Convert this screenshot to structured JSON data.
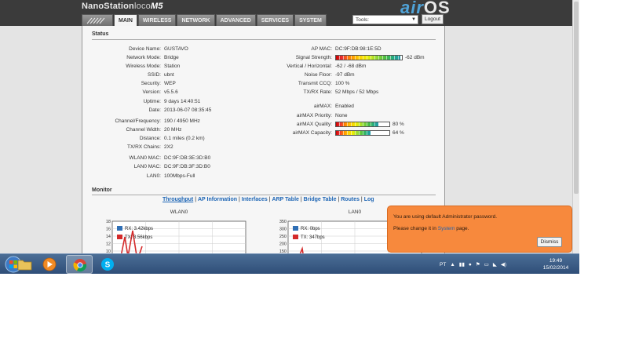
{
  "header": {
    "brand_name": "NanoStation",
    "brand_loco": "loco",
    "brand_model": "M5",
    "airos_air": "air",
    "airos_os": "OS"
  },
  "tabs": [
    {
      "label": "MAIN",
      "active": true
    },
    {
      "label": "WIRELESS",
      "active": false
    },
    {
      "label": "NETWORK",
      "active": false
    },
    {
      "label": "ADVANCED",
      "active": false
    },
    {
      "label": "SERVICES",
      "active": false
    },
    {
      "label": "SYSTEM",
      "active": false
    }
  ],
  "tools": {
    "selected": "Tools:"
  },
  "logout_label": "Logout",
  "status": {
    "title": "Status",
    "left": [
      {
        "label": "Device Name:",
        "value": "GUSTAVO"
      },
      {
        "label": "Network Mode:",
        "value": "Bridge"
      },
      {
        "label": "Wireless Mode:",
        "value": "Station"
      },
      {
        "label": "SSID:",
        "value": "ubnt"
      },
      {
        "label": "Security:",
        "value": "WEP"
      },
      {
        "label": "Version:",
        "value": "v5.5.6"
      },
      {
        "label": "Uptime:",
        "value": "9 days 14:40:51"
      },
      {
        "label": "Date:",
        "value": "2013-06-07 08:35:45"
      },
      {
        "label": "Channel/Frequency:",
        "value": "190 / 4950 MHz"
      },
      {
        "label": "Channel Width:",
        "value": "20 MHz"
      },
      {
        "label": "Distance:",
        "value": "0.1 miles (0.2 km)"
      },
      {
        "label": "TX/RX Chains:",
        "value": "2X2"
      },
      {
        "label": "WLAN0 MAC:",
        "value": "DC:9F:DB:3E:3D:B0"
      },
      {
        "label": "LAN0 MAC:",
        "value": "DC:9F:DB:3F:3D:B0"
      },
      {
        "label": "LAN0:",
        "value": "100Mbps-Full"
      }
    ],
    "right": [
      {
        "label": "AP MAC:",
        "value": "DC:9F:DB:98:1E:5D"
      },
      {
        "label": "Signal Strength:",
        "value": "-62 dBm",
        "bar": 0.98
      },
      {
        "label": "Vertical / Horizontal:",
        "value": "-62 / -68 dBm"
      },
      {
        "label": "Noise Floor:",
        "value": "-97 dBm"
      },
      {
        "label": "Transmit CCQ:",
        "value": "100 %"
      },
      {
        "label": "TX/RX Rate:",
        "value": "52 Mbps / 52 Mbps"
      },
      {
        "label": "airMAX:",
        "value": "Enabled"
      },
      {
        "label": "airMAX Priority:",
        "value": "None"
      },
      {
        "label": "airMAX Quality:",
        "value": "80 %",
        "bar": 0.8
      },
      {
        "label": "airMAX Capacity:",
        "value": "64 %",
        "bar": 0.64
      }
    ]
  },
  "monitor": {
    "title": "Monitor",
    "links": [
      "Throughput",
      "AP Information",
      "Interfaces",
      "ARP Table",
      "Bridge Table",
      "Routes",
      "Log"
    ],
    "separator": " | "
  },
  "chart_data": [
    {
      "type": "line",
      "title": "WLAN0",
      "ylim": [
        0,
        18
      ],
      "yticks": [
        18,
        16,
        14,
        12,
        10
      ],
      "series": [
        {
          "name": "RX: 3.42kbps",
          "color": "#2f6fb5"
        },
        {
          "name": "TX: 3.56kbps",
          "color": "#d42a2a"
        }
      ]
    },
    {
      "type": "line",
      "title": "LAN0",
      "ylim": [
        0,
        350
      ],
      "yticks": [
        350,
        300,
        250,
        200,
        150
      ],
      "series": [
        {
          "name": "RX: 0bps",
          "color": "#2f6fb5"
        },
        {
          "name": "TX: 347bps",
          "color": "#d42a2a"
        }
      ]
    }
  ],
  "popup": {
    "line1": "You are using default Administrator password.",
    "line2_pre": "Please change it in ",
    "line2_link": "System",
    "line2_post": " page.",
    "dismiss": "Dismiss"
  },
  "taskbar": {
    "icons": [
      "start-orb",
      "file-explorer",
      "media-player",
      "chrome",
      "skype"
    ],
    "lang": "PT",
    "time": "19:49",
    "date": "15/02/2014"
  }
}
